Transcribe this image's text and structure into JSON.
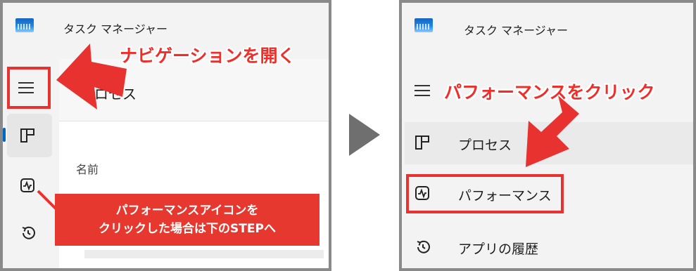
{
  "left_panel": {
    "window_title": "タスク マネージャー",
    "page_heading": "プロセス",
    "column_header": "名前",
    "annotation_open_nav": "ナビゲーションを開く",
    "callout_lines": [
      "パフォーマンスアイコンを",
      "クリックした場合は下のSTEPへ"
    ],
    "nav_icons": [
      "processes-icon",
      "performance-icon",
      "app-history-icon"
    ]
  },
  "right_panel": {
    "window_title": "タスク マネージャー",
    "annotation_click": "パフォーマンスをクリック",
    "menu": [
      {
        "label": "プロセス",
        "icon": "processes-icon"
      },
      {
        "label": "パフォーマンス",
        "icon": "performance-icon"
      },
      {
        "label": "アプリの履歴",
        "icon": "app-history-icon"
      }
    ]
  },
  "colors": {
    "annotation_red": "#e8322f",
    "panel_border": "#8a8a8a",
    "selection_accent": "#0067c0",
    "step_arrow": "#6f6f6f"
  }
}
